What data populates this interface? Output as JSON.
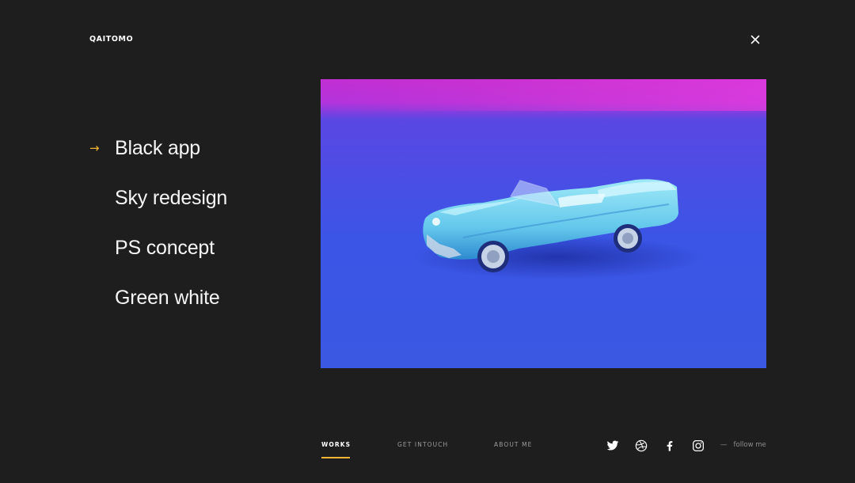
{
  "header": {
    "logo": "QAITOMO",
    "close_icon": "close-icon"
  },
  "menu": {
    "active_index": 0,
    "arrow_icon": "arrow-right-icon",
    "items": [
      {
        "label": "Black app"
      },
      {
        "label": "Sky redesign"
      },
      {
        "label": "PS concept"
      },
      {
        "label": "Green white"
      }
    ]
  },
  "hero": {
    "image": "photo of a light-blue toy convertible car on a blue background with magenta light"
  },
  "bottom_nav": {
    "active_index": 0,
    "links": [
      {
        "label": "WORKS"
      },
      {
        "label": "GET INTOUCH"
      },
      {
        "label": "ABOUT ME"
      }
    ]
  },
  "social": {
    "icons": [
      "twitter-icon",
      "dribbble-icon",
      "facebook-icon",
      "instagram-icon"
    ],
    "follow_label": "follow me"
  },
  "colors": {
    "background": "#1e1e1e",
    "accent": "#f2b632",
    "text": "#ffffff",
    "muted": "#9d9d9d"
  }
}
